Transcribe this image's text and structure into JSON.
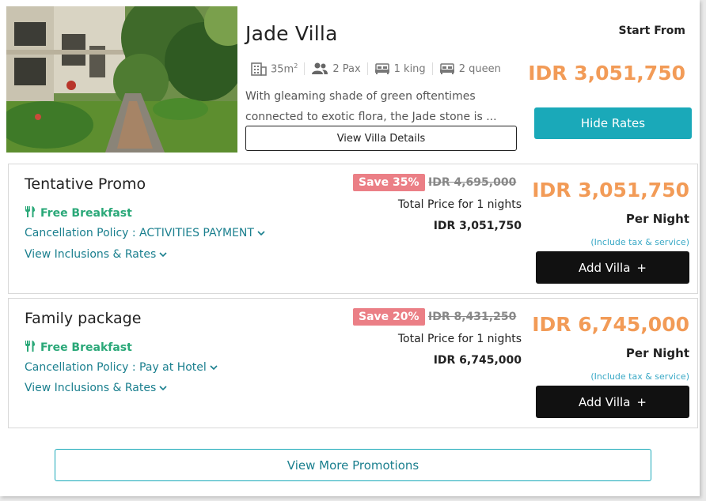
{
  "villa": {
    "name": "Jade Villa",
    "photo_icon": "villa-garden-photo",
    "amenities": {
      "size": "35m",
      "size_sup": "2",
      "pax": "2 Pax",
      "king": "1 king",
      "queen": "2 queen"
    },
    "description_line1": "With gleaming shade of green oftentimes",
    "description_line2": "connected to exotic flora, the Jade stone is ...",
    "details_button": "View Villa Details",
    "start_from_label": "Start From",
    "start_price": "IDR 3,051,750",
    "hide_rates_button": "Hide Rates"
  },
  "rates": [
    {
      "name": "Tentative Promo",
      "breakfast": "Free Breakfast",
      "cancellation": "Cancellation Policy : ACTIVITIES PAYMENT",
      "inclusions": "View Inclusions & Rates",
      "save_badge": "Save 35%",
      "old_price": "IDR 4,695,000",
      "total_label": "Total Price for 1 nights",
      "total_value": "IDR 3,051,750",
      "price": "IDR 3,051,750",
      "per_night": "Per Night",
      "tax_note": "(Include tax & service)",
      "add_button": "Add Villa",
      "add_symbol": "+"
    },
    {
      "name": "Family package",
      "breakfast": "Free Breakfast",
      "cancellation": "Cancellation Policy : Pay at Hotel",
      "inclusions": "View Inclusions & Rates",
      "save_badge": "Save 20%",
      "old_price": "IDR 8,431,250",
      "total_label": "Total Price for 1 nights",
      "total_value": "IDR 6,745,000",
      "price": "IDR 6,745,000",
      "per_night": "Per Night",
      "tax_note": "(Include tax & service)",
      "add_button": "Add Villa",
      "add_symbol": "+"
    }
  ],
  "more_button": "View More Promotions",
  "colors": {
    "accent_teal": "#1aa9b9",
    "price_orange": "#f29b57",
    "save_badge": "#eb7f86",
    "breakfast_green": "#2aa878",
    "link_teal": "#1a7f8e"
  },
  "icons": [
    "building-icon",
    "people-icon",
    "bed-icon",
    "utensils-icon",
    "chevron-down-icon",
    "plus-icon"
  ]
}
